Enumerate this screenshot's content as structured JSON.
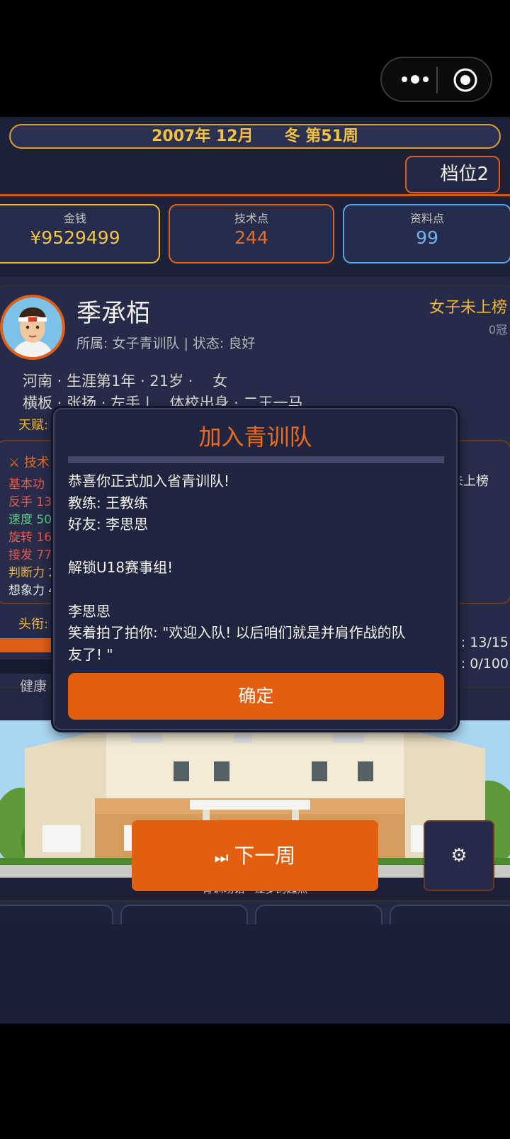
{
  "header": {
    "date_text": "2007年 12月　　冬 第51周",
    "tier_label": "档位2"
  },
  "resources": {
    "money": {
      "label": "金钱",
      "value": "¥9529499"
    },
    "tech": {
      "label": "技术点",
      "value": "244"
    },
    "info": {
      "label": "资料点",
      "value": "99"
    }
  },
  "player": {
    "name": "季承栢",
    "team_status": "所属: 女子青训队 | 状态: 良好",
    "rank": "女子未上榜",
    "crowns": "0冠",
    "line1": "河南 · 生涯第1年 · 21岁 ·　 女",
    "line2": "横板 · 张扬 · 左手 |　 体校出身 · 二王一马",
    "talent_label": "天赋:",
    "title_label": "头衔:",
    "health_label": "健康",
    "stat_right_1": "力: 13/15",
    "stat_right_2": "力: 0/100"
  },
  "skills": {
    "header": "⚔ 技术",
    "items": [
      "基本功",
      "反手 13",
      "速度 50",
      "旋转 16",
      "接发 77",
      "判断力 2",
      "想象力 4"
    ],
    "right_text": "未上榜"
  },
  "scene": {
    "caption": "青训场馆 · 逐梦的起点"
  },
  "bottom": {
    "next_week_icon": "⏭",
    "next_week_label": "下一周",
    "settings_icon": "⚙"
  },
  "modal": {
    "title": "加入青训队",
    "lines": [
      "恭喜你正式加入省青训队!",
      "教练: 王教练",
      "好友: 李思思",
      "",
      "解锁U18赛事组!",
      "",
      "李思思",
      "笑着拍了拍你: \"欢迎入队! 以后咱们就是并肩作战的队",
      "友了! \""
    ],
    "confirm_label": "确定"
  },
  "colors": {
    "accent_orange": "#e35f0f",
    "gold": "#f4c640",
    "info_blue": "#6cb3f0",
    "panel": "#232944"
  }
}
